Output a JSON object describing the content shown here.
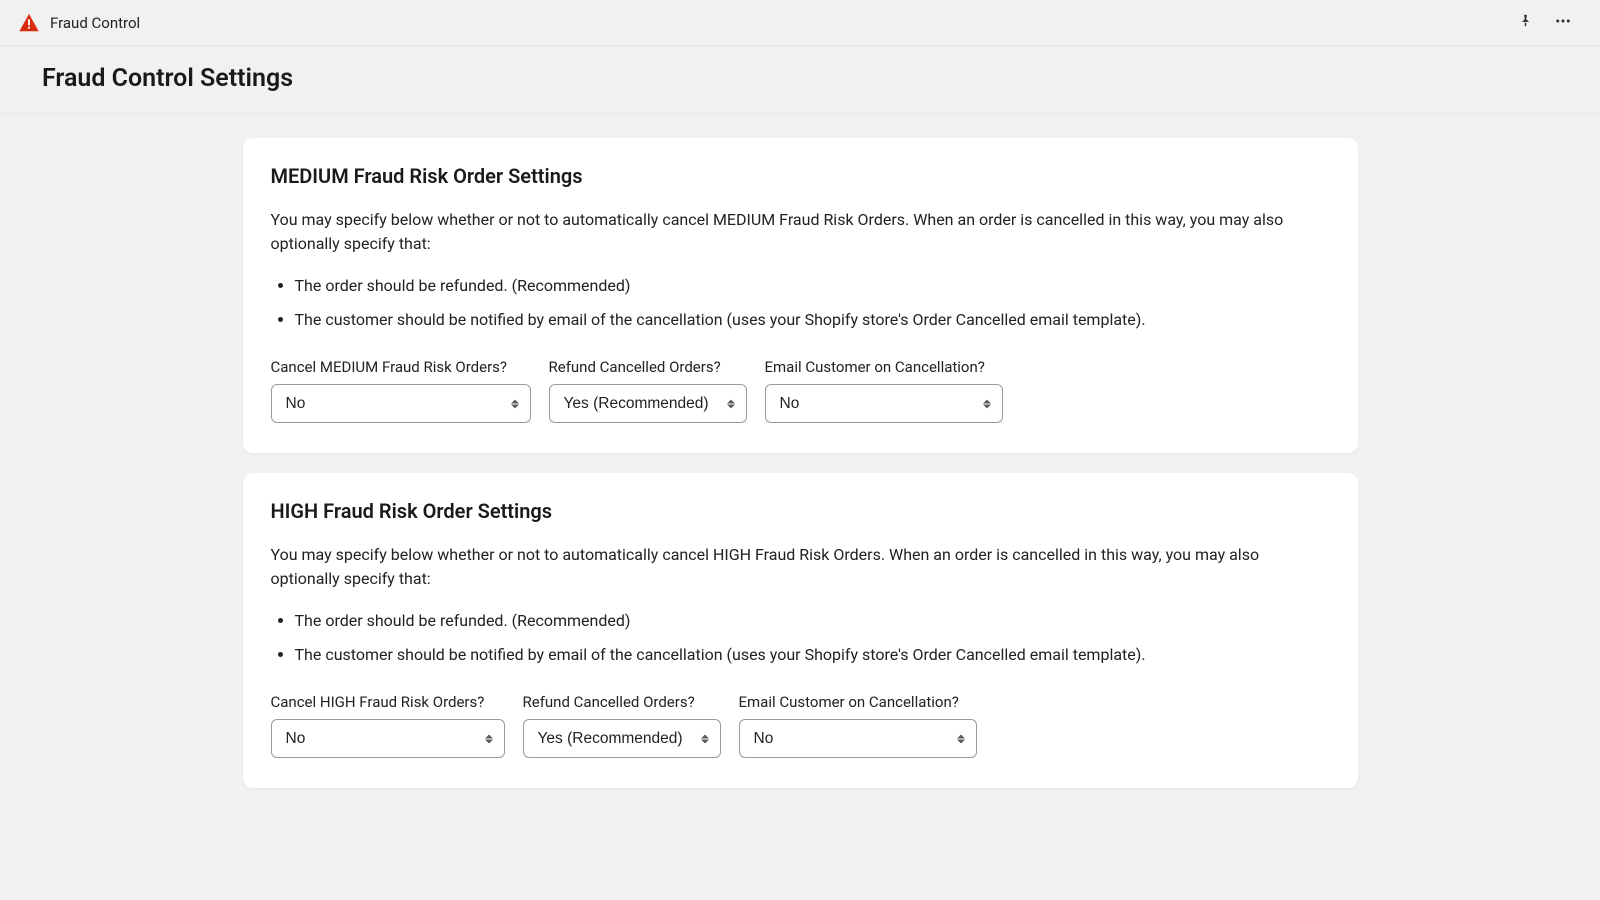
{
  "header": {
    "app_title": "Fraud Control"
  },
  "page_title": "Fraud Control Settings",
  "medium": {
    "title": "MEDIUM Fraud Risk Order Settings",
    "desc": "You may specify below whether or not to automatically cancel MEDIUM Fraud Risk Orders. When an order is cancelled in this way, you may also optionally specify that:",
    "bullet1": "The order should be refunded. (Recommended)",
    "bullet2": "The customer should be notified by email of the cancellation (uses your Shopify store's Order Cancelled email template).",
    "label_cancel": "Cancel MEDIUM Fraud Risk Orders?",
    "label_refund": "Refund Cancelled Orders?",
    "label_email": "Email Customer on Cancellation?",
    "value_cancel": "No",
    "value_refund": "Yes (Recommended)",
    "value_email": "No"
  },
  "high": {
    "title": "HIGH Fraud Risk Order Settings",
    "desc": "You may specify below whether or not to automatically cancel HIGH Fraud Risk Orders. When an order is cancelled in this way, you may also optionally specify that:",
    "bullet1": "The order should be refunded. (Recommended)",
    "bullet2": "The customer should be notified by email of the cancellation (uses your Shopify store's Order Cancelled email template).",
    "label_cancel": "Cancel HIGH Fraud Risk Orders?",
    "label_refund": "Refund Cancelled Orders?",
    "label_email": "Email Customer on Cancellation?",
    "value_cancel": "No",
    "value_refund": "Yes (Recommended)",
    "value_email": "No"
  }
}
